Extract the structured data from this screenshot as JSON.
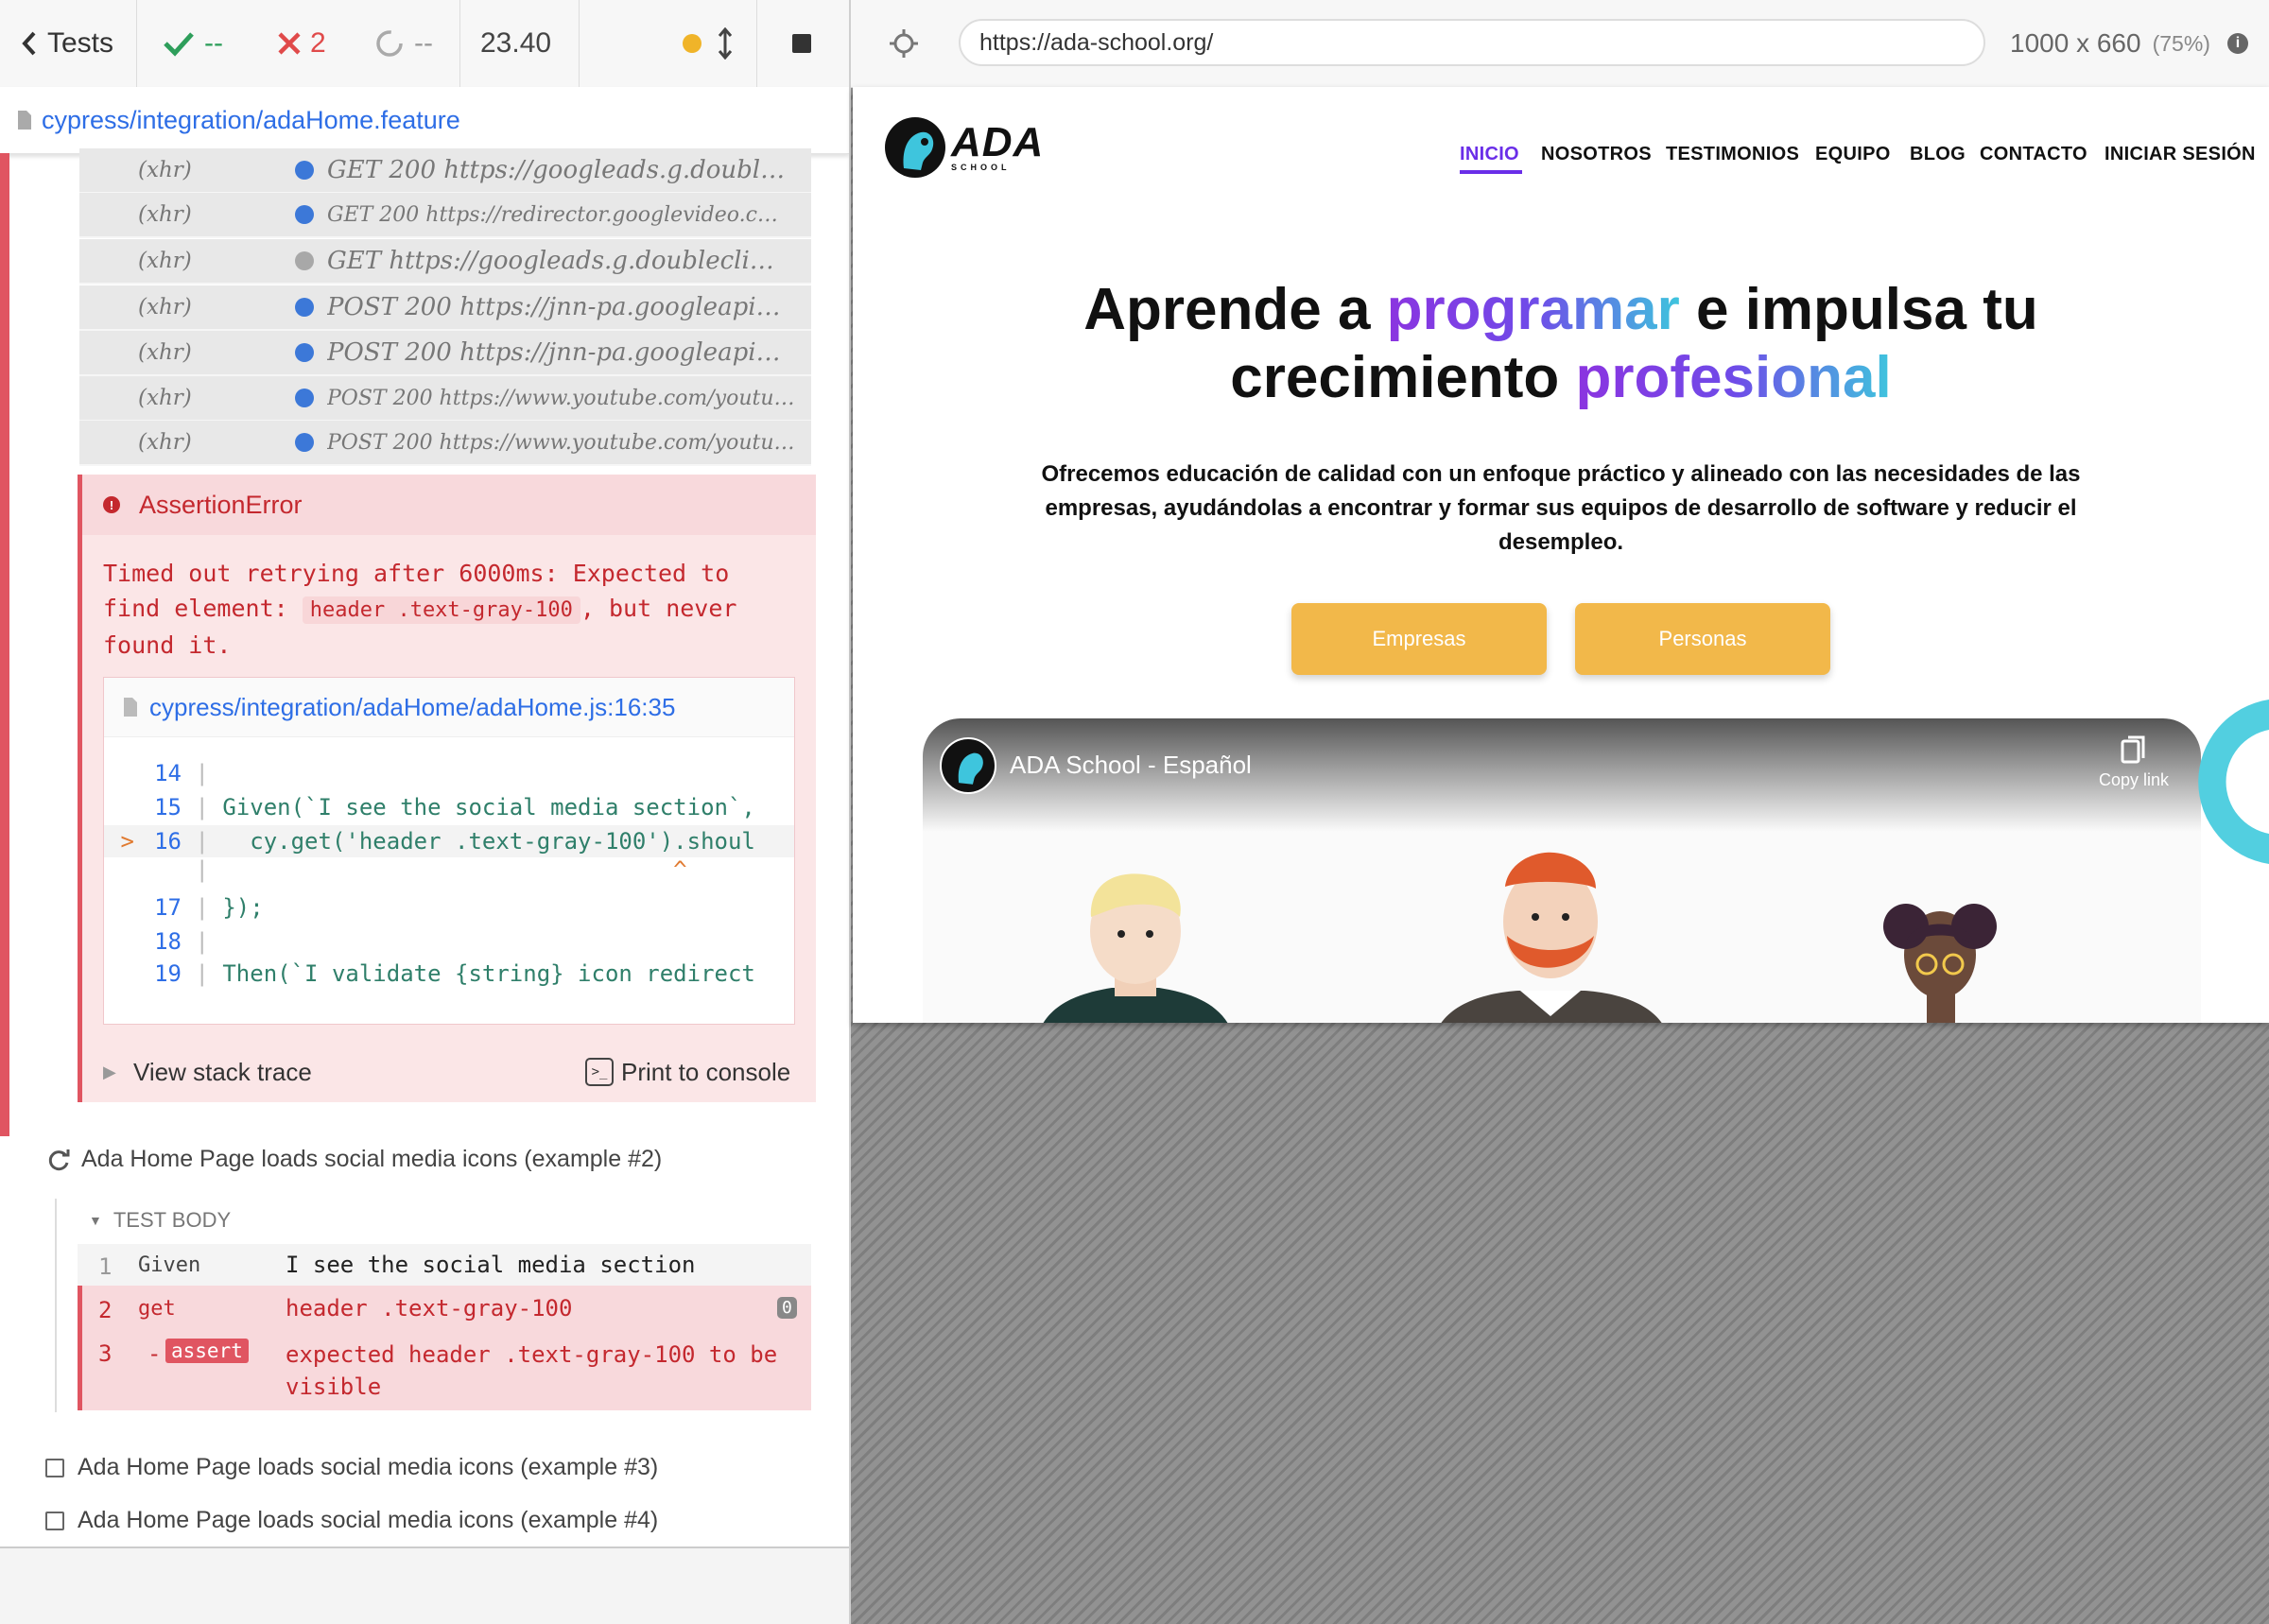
{
  "toolbar": {
    "tests_label": "Tests",
    "passed": "--",
    "failed": "2",
    "pending": "--",
    "duration": "23.40",
    "colors": {
      "passed": "#2e9e5b",
      "failed": "#e04a4a",
      "pending": "#999999",
      "running": "#f0b429"
    }
  },
  "spec": {
    "path": "cypress/integration/adaHome.feature"
  },
  "xhr_rows": [
    {
      "kind": "(xhr)",
      "status": "blue",
      "request": "GET 200 https://googleads.g.doubl…"
    },
    {
      "kind": "(xhr)",
      "status": "blue",
      "request": "GET 200 https://redirector.googlevideo.c…"
    },
    {
      "kind": "(xhr)",
      "status": "gray",
      "request": "GET https://googleads.g.doublecli…"
    },
    {
      "kind": "(xhr)",
      "status": "blue",
      "request": "POST 200 https://jnn-pa.googleapi…"
    },
    {
      "kind": "(xhr)",
      "status": "blue",
      "request": "POST 200 https://jnn-pa.googleapi…"
    },
    {
      "kind": "(xhr)",
      "status": "blue",
      "request": "POST 200 https://www.youtube.com/youtube…"
    },
    {
      "kind": "(xhr)",
      "status": "blue",
      "request": "POST 200 https://www.youtube.com/youtube…"
    }
  ],
  "error": {
    "name": "AssertionError",
    "msg_part1": "Timed out retrying after 6000ms: Expected to find element:",
    "msg_code": "header .text-gray-100",
    "msg_part2": ", but never found it.",
    "file": "cypress/integration/adaHome/adaHome.js:16:35",
    "code": [
      {
        "marker": " ",
        "num": "14",
        "text": ""
      },
      {
        "marker": " ",
        "num": "15",
        "text": "Given(`I see the social media section`,"
      },
      {
        "marker": ">",
        "num": "16",
        "text": "  cy.get('header .text-gray-100').shoul"
      },
      {
        "marker": " ",
        "num": "",
        "text": "                                 ^"
      },
      {
        "marker": " ",
        "num": "17",
        "text": "});"
      },
      {
        "marker": " ",
        "num": "18",
        "text": ""
      },
      {
        "marker": " ",
        "num": "19",
        "text": "Then(`I validate {string} icon redirect"
      }
    ],
    "view_stack": "View stack trace",
    "print_console": "Print to console"
  },
  "tests": {
    "retrying_title": "Ada Home Page loads social media icons (example #2)",
    "test_body": "TEST BODY",
    "commands": [
      {
        "num": "1",
        "name": "Given",
        "message": "I see the social media section"
      },
      {
        "num": "2",
        "name": "get",
        "message": "header .text-gray-100",
        "badge": "0"
      },
      {
        "num": "3",
        "name": "-",
        "tag": "assert",
        "message": "expected header .text-gray-100 to be visible"
      }
    ],
    "pending_titles": [
      "Ada Home Page loads social media icons (example #3)",
      "Ada Home Page loads social media icons (example #4)"
    ]
  },
  "aut": {
    "url": "https://ada-school.org/",
    "viewport": "1000 x 660",
    "scale": "(75%)",
    "logo": {
      "name": "ADA",
      "sub": "SCHOOL"
    },
    "nav": [
      "INICIO",
      "NOSOTROS",
      "TESTIMONIOS",
      "EQUIPO",
      "BLOG",
      "CONTACTO",
      "INICIAR SESIÓN"
    ],
    "active_nav": "INICIO",
    "hero": {
      "l1_a": "Aprende a ",
      "l1_b": "programar",
      "l1_c": " e impulsa tu",
      "l2_a": "crecimiento ",
      "l2_b": "profesional"
    },
    "subtitle": "Ofrecemos educación de calidad con un enfoque práctico y alineado con las necesidades de las empresas, ayudándolas a encontrar y formar sus equipos de desarrollo de software y reducir el desempleo.",
    "buttons": [
      "Empresas",
      "Personas"
    ],
    "video": {
      "title": "ADA School - Español",
      "copy_link": "Copy link"
    },
    "brand_color": "#6a2ee8",
    "accent_color": "#f2b84a"
  }
}
